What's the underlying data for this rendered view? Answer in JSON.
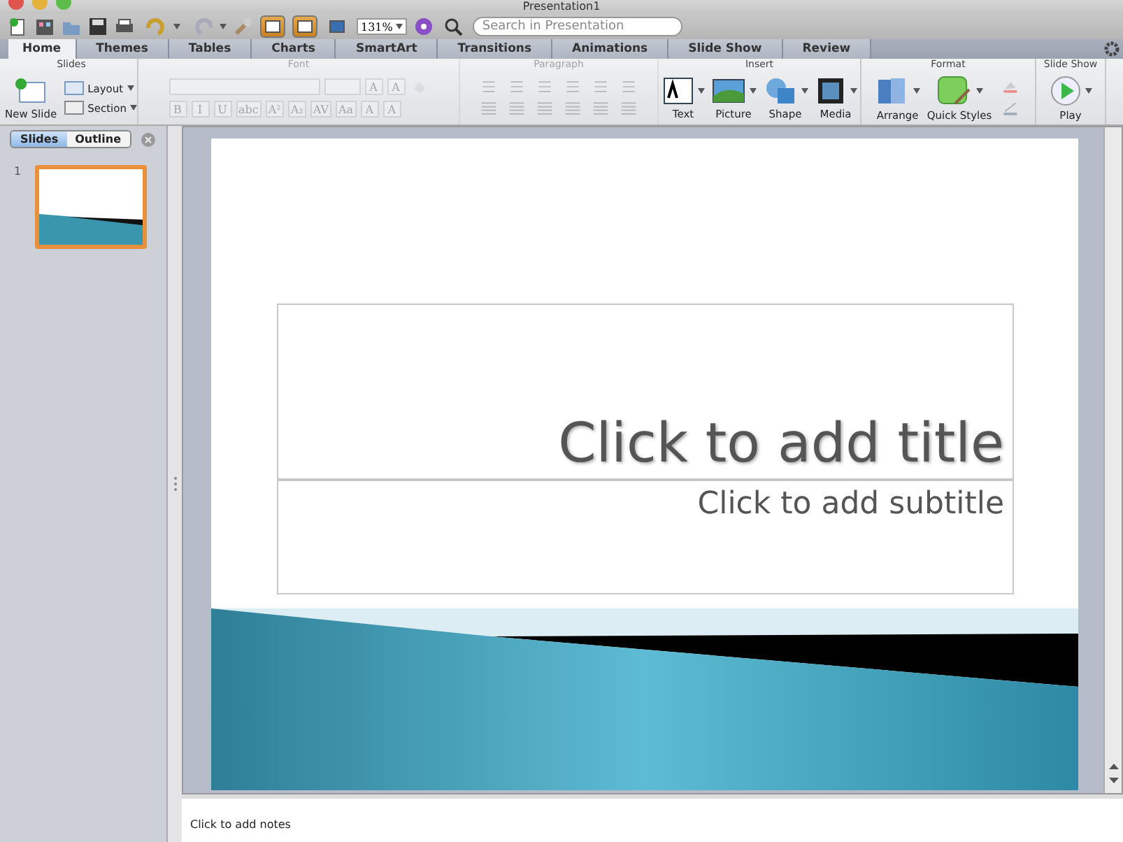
{
  "window": {
    "title": "Presentation1"
  },
  "toolbar": {
    "view_buttons": [
      {
        "selected": true
      },
      {
        "selected": true
      },
      {
        "selected": false
      }
    ],
    "zoom": "131%",
    "search": {
      "placeholder": "Search in Presentation"
    }
  },
  "tabs": [
    {
      "label": "Home",
      "selected": true
    },
    {
      "label": "Themes",
      "selected": false
    },
    {
      "label": "Tables",
      "selected": false
    },
    {
      "label": "Charts",
      "selected": false
    },
    {
      "label": "SmartArt",
      "selected": false
    },
    {
      "label": "Transitions",
      "selected": false
    },
    {
      "label": "Animations",
      "selected": false
    },
    {
      "label": "Slide Show",
      "selected": false
    },
    {
      "label": "Review",
      "selected": false
    }
  ],
  "ribbon": {
    "groups": [
      {
        "kind": "slides",
        "title": "Slides",
        "disabled": false,
        "buttons": [
          "New Slide",
          "Layout",
          "Section"
        ]
      },
      {
        "kind": "font",
        "title": "Font",
        "disabled": true,
        "size_buttons": [
          "A",
          "A"
        ],
        "format_buttons": [
          "B",
          "I",
          "U",
          "abc",
          "A²",
          "A₂",
          "AV",
          "Aa",
          "A",
          "A"
        ]
      },
      {
        "kind": "paragraph",
        "title": "Paragraph",
        "disabled": true
      },
      {
        "kind": "insert",
        "title": "Insert",
        "disabled": false,
        "buttons": [
          "Text",
          "Picture",
          "Shape",
          "Media"
        ]
      },
      {
        "kind": "format",
        "title": "Format",
        "disabled": false,
        "buttons": [
          "Arrange",
          "Quick Styles"
        ]
      },
      {
        "kind": "slideshow",
        "title": "Slide Show",
        "disabled": false,
        "buttons": [
          "Play"
        ]
      }
    ]
  },
  "sidebar": {
    "view_tabs": [
      {
        "label": "Slides",
        "selected": true
      },
      {
        "label": "Outline",
        "selected": false
      }
    ],
    "slides": [
      {
        "number": "1",
        "selected": true
      }
    ]
  },
  "slide": {
    "title_placeholder": "Click to add title",
    "subtitle_placeholder": "Click to add subtitle"
  },
  "notes": {
    "placeholder": "Click to add notes"
  }
}
